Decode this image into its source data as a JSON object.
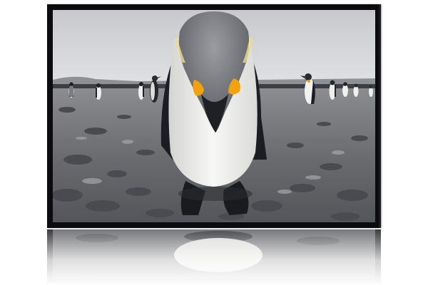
{
  "image": {
    "subject": "king-penguin-photo",
    "colors": {
      "sky": "#d9dadd",
      "ground": "#6a6b6f",
      "frame": "#0c0c0e",
      "penguin_head": "#7d7f85",
      "penguin_chest": "#f1f1ee",
      "penguin_patch": "#f2a10f",
      "penguin_back": "#1c1d22"
    }
  }
}
